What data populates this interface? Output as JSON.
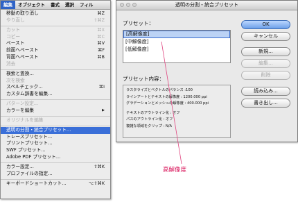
{
  "menubar": {
    "items": [
      {
        "label": "編集",
        "active": true
      },
      {
        "label": "オブジェクト",
        "active": false
      },
      {
        "label": "書式",
        "active": false
      },
      {
        "label": "選択",
        "active": false
      },
      {
        "label": "フィル",
        "active": false
      }
    ]
  },
  "edit_menu": {
    "items": [
      {
        "label": "移動の取り消し",
        "shortcut": "⌘Z",
        "state": "enabled"
      },
      {
        "label": "やり直し",
        "shortcut": "⇧⌘Z",
        "state": "disabled"
      },
      {
        "separator": true
      },
      {
        "label": "カット",
        "shortcut": "⌘X",
        "state": "disabled"
      },
      {
        "label": "コピー",
        "shortcut": "⌘C",
        "state": "disabled"
      },
      {
        "label": "ペースト",
        "shortcut": "⌘V",
        "state": "enabled"
      },
      {
        "label": "前面へペースト",
        "shortcut": "⌘F",
        "state": "enabled"
      },
      {
        "label": "背面へペースト",
        "shortcut": "⌘B",
        "state": "enabled"
      },
      {
        "label": "消去",
        "shortcut": "",
        "state": "disabled"
      },
      {
        "separator": true
      },
      {
        "label": "検索と置換...",
        "shortcut": "",
        "state": "enabled"
      },
      {
        "label": "次を検索",
        "shortcut": "",
        "state": "disabled"
      },
      {
        "label": "スペルチェック...",
        "shortcut": "⌘I",
        "state": "enabled"
      },
      {
        "label": "カスタム辞書を編集...",
        "shortcut": "",
        "state": "enabled"
      },
      {
        "separator": true
      },
      {
        "label": "パターン設定...",
        "shortcut": "",
        "state": "disabled"
      },
      {
        "label": "カラーを編集",
        "shortcut": "",
        "state": "enabled",
        "submenu": true
      },
      {
        "separator": true
      },
      {
        "label": "オリジナルを編集",
        "shortcut": "",
        "state": "disabled"
      },
      {
        "separator": true
      },
      {
        "label": "透明の分割・統合プリセット...",
        "shortcut": "",
        "state": "selected"
      },
      {
        "label": "トレースプリセット...",
        "shortcut": "",
        "state": "enabled"
      },
      {
        "label": "プリントプリセット...",
        "shortcut": "",
        "state": "enabled"
      },
      {
        "label": "SWF プリセット...",
        "shortcut": "",
        "state": "enabled"
      },
      {
        "label": "Adobe PDF プリセット...",
        "shortcut": "",
        "state": "enabled"
      },
      {
        "separator": true
      },
      {
        "label": "カラー設定...",
        "shortcut": "⇧⌘K",
        "state": "enabled"
      },
      {
        "label": "プロファイルの指定...",
        "shortcut": "",
        "state": "enabled"
      },
      {
        "separator": true
      },
      {
        "label": "キーボードショートカット...",
        "shortcut": "⌥⇧⌘K",
        "state": "enabled"
      }
    ]
  },
  "dialog": {
    "title": "透明の分割・統合プリセット",
    "presets_label": "プリセット：",
    "presets": [
      {
        "label": "[高解像度]",
        "selected": true
      },
      {
        "label": "[中解像度]",
        "selected": false
      },
      {
        "label": "[低解像度]",
        "selected": false
      }
    ],
    "buttons": {
      "ok": "OK",
      "cancel": "キャンセル",
      "new": "新規...",
      "edit": "編集...",
      "delete": "削除",
      "load": "読み込み...",
      "save": "書き出し..."
    },
    "content_label": "プリセット内容：",
    "content_lines": [
      "ラスタライズとベクトルのバランス :100",
      "ラインアートとテキストの解像度 : 1200.000 ppi",
      "グラデーションとメッシュの解像度 : 400.000 ppi",
      "",
      "テキストのアウトライン化 : オフ",
      "パスのアウトライン化 : オフ",
      "複雑な領域をクリップ : N/A"
    ]
  },
  "annotation": {
    "label": "高解像度",
    "color": "#d9145a"
  },
  "colors": {
    "menu_highlight": "#3a6fd8",
    "list_selection": "#bcd3f5",
    "default_button": "#6c9fe8"
  }
}
